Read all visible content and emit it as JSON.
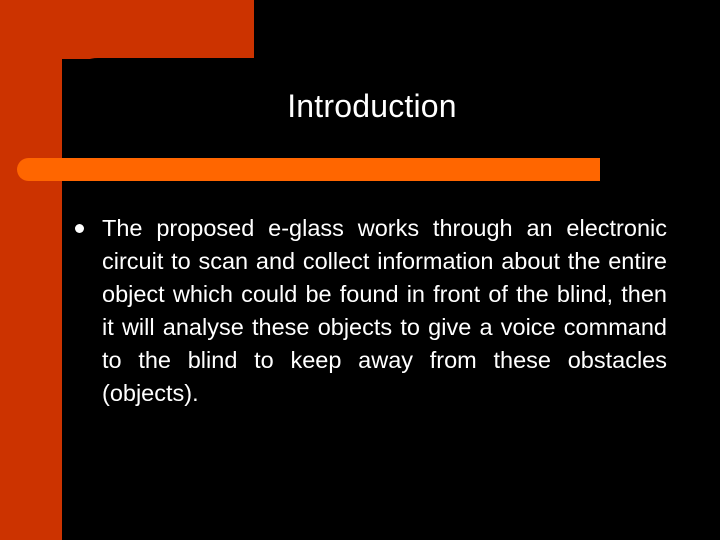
{
  "slide": {
    "title": "Introduction",
    "bullets": [
      {
        "marker": "●",
        "text": "The proposed e-glass works through an electronic circuit to scan and collect information about the entire object which could be found in front of the blind, then it will analyse these objects to give a voice command to the blind to keep away from these obstacles (objects)."
      }
    ],
    "colors": {
      "background": "#000000",
      "accent_red": "#cc3300",
      "accent_orange": "#ff6600",
      "text": "#ffffff"
    }
  }
}
